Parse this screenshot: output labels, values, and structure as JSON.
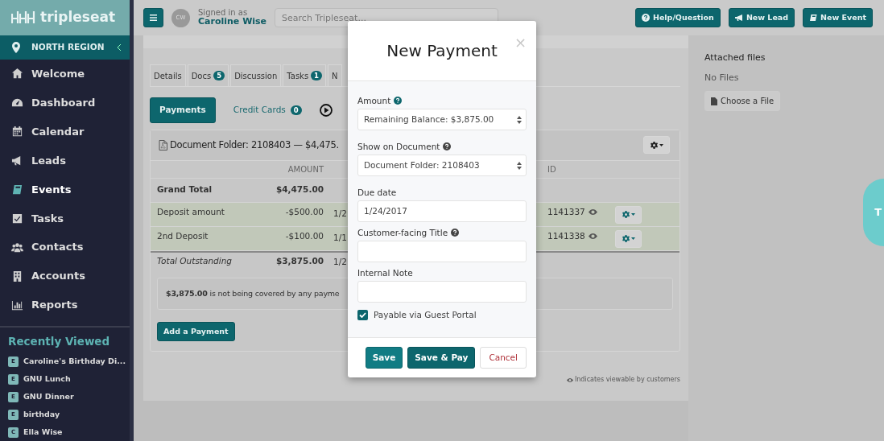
{
  "sidebar": {
    "logo": "tripleseat",
    "region": "NORTH REGION",
    "items": [
      {
        "label": "Welcome",
        "selected": false
      },
      {
        "label": "Dashboard",
        "selected": false
      },
      {
        "label": "Calendar",
        "selected": false
      },
      {
        "label": "Leads",
        "selected": false
      },
      {
        "label": "Events",
        "selected": true
      },
      {
        "label": "Tasks",
        "selected": false
      },
      {
        "label": "Contacts",
        "selected": false
      },
      {
        "label": "Accounts",
        "selected": false
      },
      {
        "label": "Reports",
        "selected": false
      }
    ],
    "recent_heading": "Recently Viewed",
    "recent": [
      {
        "badge": "E",
        "label": "Caroline's Birthday Di..."
      },
      {
        "badge": "E",
        "label": "GNU Lunch"
      },
      {
        "badge": "E",
        "label": "GNU Dinner"
      },
      {
        "badge": "E",
        "label": "birthday"
      },
      {
        "badge": "C",
        "label": "Ella Wise"
      }
    ]
  },
  "topbar": {
    "initials": "CW",
    "signed_in_label": "Signed in as",
    "user": "Caroline Wise",
    "search": {
      "placeholder": "Search Tripleseat..."
    },
    "buttons": [
      "Help/Question",
      "New Lead",
      "New Event"
    ]
  },
  "tabs": [
    {
      "label": "Details"
    },
    {
      "label": "Docs",
      "badge": "5"
    },
    {
      "label": "Discussion"
    },
    {
      "label": "Tasks",
      "badge": "1"
    },
    {
      "label": "N"
    }
  ],
  "subtabs": [
    {
      "label": "Payments",
      "selected": true
    },
    {
      "label": "Credit Cards",
      "badge": "0",
      "selected": false
    }
  ],
  "folder": {
    "title": "Document Folder: 2108403 — $4,475.",
    "columns": {
      "amount": "AMOUNT",
      "id": "ID"
    },
    "rows": [
      {
        "kind": "total",
        "label": "Grand Total",
        "amount": "$4,475.00"
      },
      {
        "kind": "payment",
        "label": "Deposit amount",
        "amount": "-$500.00",
        "date": "1/2",
        "id": "1141337"
      },
      {
        "kind": "payment",
        "label": "2nd Deposit",
        "amount": "-$100.00",
        "date": "1/1",
        "id": "1141338"
      },
      {
        "kind": "outstanding",
        "label": "Total Outstanding",
        "amount": "$3,875.00",
        "date": "1/2"
      }
    ],
    "notice": "**$3,875.00** is not being covered by any payme",
    "add_button": "Add a Payment"
  },
  "footnote": "Indicates viewable by customers",
  "attached": {
    "heading": "Attached files",
    "empty": "No Files",
    "button": "Choose a File"
  },
  "side_tab": "T",
  "modal": {
    "title": "New Payment",
    "close": "×",
    "fields": [
      {
        "kind": "select",
        "label": "Amount",
        "help": true,
        "value": "Remaining Balance: $3,875.00"
      },
      {
        "kind": "select",
        "label": "Show on Document",
        "help": true,
        "value": "Document Folder: 2108403"
      },
      {
        "kind": "text",
        "label": "Due date",
        "help": false,
        "value": "1/24/2017"
      },
      {
        "kind": "text",
        "label": "Customer-facing Title",
        "help": true
      },
      {
        "kind": "text",
        "label": "Internal Note",
        "help": false
      }
    ],
    "checkbox": {
      "label": "Payable via Guest Portal",
      "checked": true
    },
    "buttons": [
      {
        "kind": "primary",
        "label": "Save"
      },
      {
        "kind": "dark",
        "label": "Save & Pay"
      },
      {
        "kind": "cancel",
        "label": "Cancel"
      }
    ]
  }
}
